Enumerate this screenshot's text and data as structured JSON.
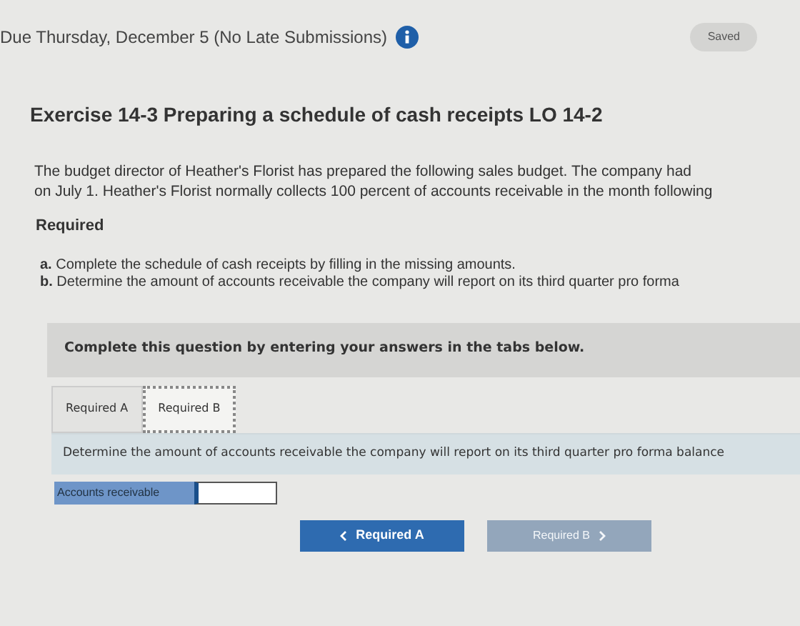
{
  "header": {
    "due": "Due Thursday, December 5 (No Late Submissions)",
    "status": "Saved"
  },
  "title": "Exercise 14-3 Preparing a schedule of cash receipts LO 14-2",
  "intro": [
    "The budget director of Heather's Florist has prepared the following sales budget. The company had",
    "on July 1. Heather's Florist normally collects 100 percent of accounts receivable in the month following"
  ],
  "required_heading": "Required",
  "requirements": [
    {
      "letter": "a.",
      "text": "Complete the schedule of cash receipts by filling in the missing amounts."
    },
    {
      "letter": "b.",
      "text": "Determine the amount of accounts receivable the company will report on its third quarter pro forma"
    }
  ],
  "instruction": "Complete this question by entering your answers in the tabs below.",
  "tabs": [
    {
      "label": "Required A",
      "selected": false
    },
    {
      "label": "Required B",
      "selected": true
    }
  ],
  "task": "Determine the amount of accounts receivable the company will report on its third quarter pro forma balance",
  "field": {
    "label": "Accounts receivable"
  },
  "nav": [
    {
      "label": "Required A",
      "kind": "prev",
      "disabled": false
    },
    {
      "label": "Required B",
      "kind": "next",
      "disabled": true
    }
  ]
}
